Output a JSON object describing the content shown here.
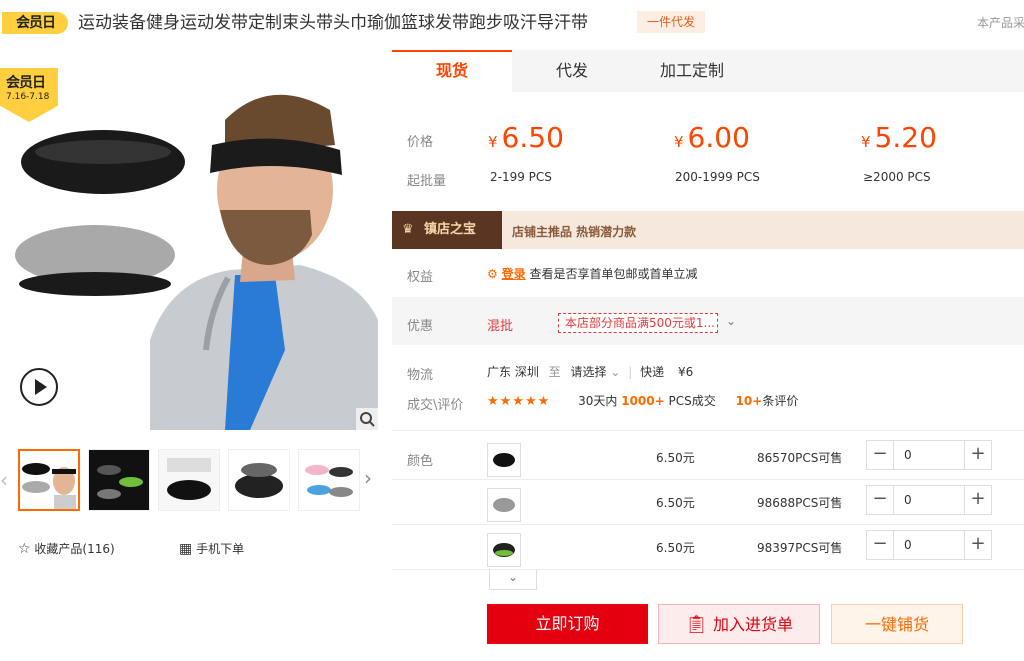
{
  "header": {
    "badge": "会员日",
    "title": "运动装备健身运动发带定制束头带头巾瑜伽篮球发带跑步吸汗导汗带",
    "dropship_tag": "一件代发",
    "product_no": "本产品采"
  },
  "gallery": {
    "member_day_label": "会员日",
    "member_day_dates": "7.16-7.18",
    "thumbnails": [
      "thumb-1",
      "thumb-2",
      "thumb-3",
      "thumb-4",
      "thumb-5"
    ],
    "favorite_label": "收藏产品(116)",
    "mobile_label": "手机下单"
  },
  "tabs": [
    "现货",
    "代发",
    "加工定制"
  ],
  "pricing": {
    "price_label": "价格",
    "moq_label": "起批量",
    "currency": "¥",
    "tiers": [
      {
        "price": "6.50",
        "range": "2-199 PCS"
      },
      {
        "price": "6.00",
        "range": "200-1999 PCS"
      },
      {
        "price": "5.20",
        "range": "≥2000 PCS"
      }
    ]
  },
  "shop_banner": {
    "title": "镇店之宝",
    "text": "店铺主推品  热销潜力款"
  },
  "benefits": {
    "label": "权益",
    "login": "登录",
    "text": "查看是否享首单包邮或首单立减"
  },
  "discount": {
    "label": "优惠",
    "type": "混批",
    "coupon": "本店部分商品满500元或1..."
  },
  "logistics": {
    "label": "物流",
    "from": "广东 深圳",
    "to_word": "至",
    "select": "请选择",
    "express": "快递",
    "fee": "¥6"
  },
  "reviews": {
    "label": "成交\\评价",
    "stars": "★★★★★",
    "days": "30天内",
    "deals": "1000+",
    "deals_suffix": "PCS成交",
    "reviews": "10+",
    "reviews_suffix": "条评价",
    "rating": 4.5
  },
  "sku": {
    "label": "颜色",
    "rows": [
      {
        "price": "6.50元",
        "stock": "86570PCS可售",
        "qty": "0"
      },
      {
        "price": "6.50元",
        "stock": "98688PCS可售",
        "qty": "0"
      },
      {
        "price": "6.50元",
        "stock": "98397PCS可售",
        "qty": "0"
      }
    ],
    "minus": "−",
    "plus": "+"
  },
  "actions": {
    "order": "立即订购",
    "cart": "加入进货单",
    "dropship": "一键铺货"
  }
}
